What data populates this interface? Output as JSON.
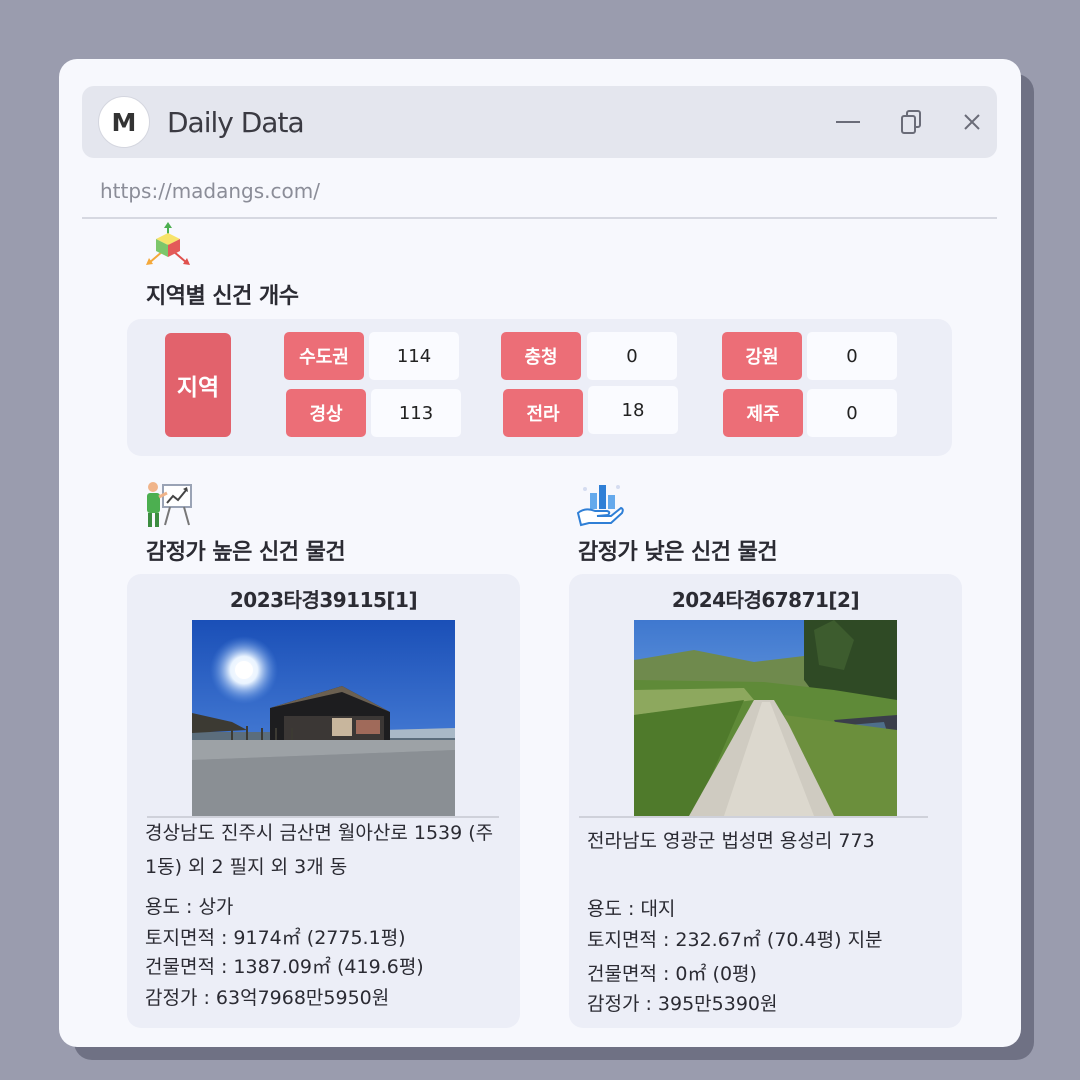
{
  "window": {
    "logo_letter": "M",
    "title": "Daily Data",
    "url": "https://madangs.com/"
  },
  "regions": {
    "section_title": "지역별 신건 개수",
    "main_label": "지역",
    "items": [
      {
        "label": "수도권",
        "value": "114"
      },
      {
        "label": "경상",
        "value": "113"
      },
      {
        "label": "충청",
        "value": "0"
      },
      {
        "label": "전라",
        "value": "18"
      },
      {
        "label": "강원",
        "value": "0"
      },
      {
        "label": "제주",
        "value": "0"
      }
    ]
  },
  "high": {
    "section_title": "감정가 높은 신건 물건",
    "case_no": "2023타경39115[1]",
    "address": "경상남도 진주시 금산면 월아산로 1539 (주1동) 외 2 필지 외 3개 동",
    "usage": "용도 : 상가",
    "land_area": "토지면적 : 9174㎡ (2775.1평)",
    "building_area": "건물면적 : 1387.09㎡ (419.6평)",
    "appraisal": "감정가 : 63억7968만5950원"
  },
  "low": {
    "section_title": "감정가 낮은 신건 물건",
    "case_no": "2024타경67871[2]",
    "address": "전라남도 영광군 법성면 용성리 773",
    "usage": "용도 : 대지",
    "land_area": "토지면적 : 232.67㎡ (70.4평) 지분",
    "building_area": "건물면적 : 0㎡ (0평)",
    "appraisal": "감정가 : 395만5390원"
  },
  "icons": {
    "region_icon": "cube-arrows-icon",
    "high_icon": "presentation-chart-icon",
    "low_icon": "hand-chart-icon"
  }
}
